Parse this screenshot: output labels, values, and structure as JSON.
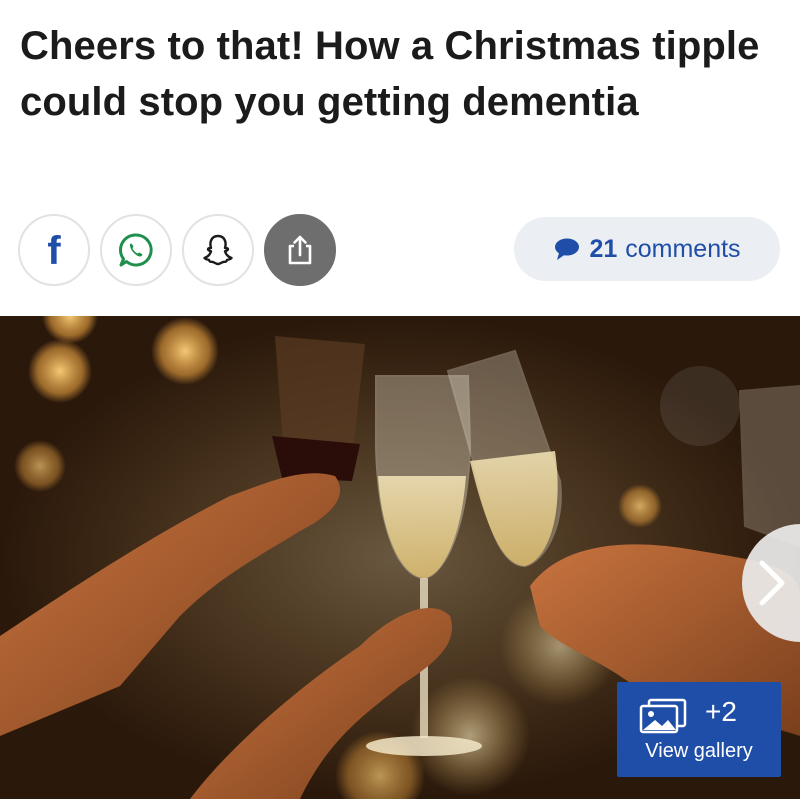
{
  "article": {
    "headline": "Cheers to that! How a Christmas tipple could stop you getting dementia"
  },
  "share": {
    "facebook_glyph": "f",
    "icons": [
      "facebook-icon",
      "whatsapp-icon",
      "snapchat-icon",
      "share-icon"
    ]
  },
  "comments": {
    "count": "21",
    "label": "comments",
    "icon": "speech-bubble-icon"
  },
  "gallery": {
    "count": "+2",
    "label": "View gallery",
    "icon": "gallery-icon"
  },
  "image": {
    "icon": "chevron-right-icon"
  },
  "colors": {
    "brand_blue": "#1f4ea8",
    "pill_bg": "#ebeef2",
    "native_share_bg": "#6e6e6e",
    "text": "#1b1b1b"
  }
}
